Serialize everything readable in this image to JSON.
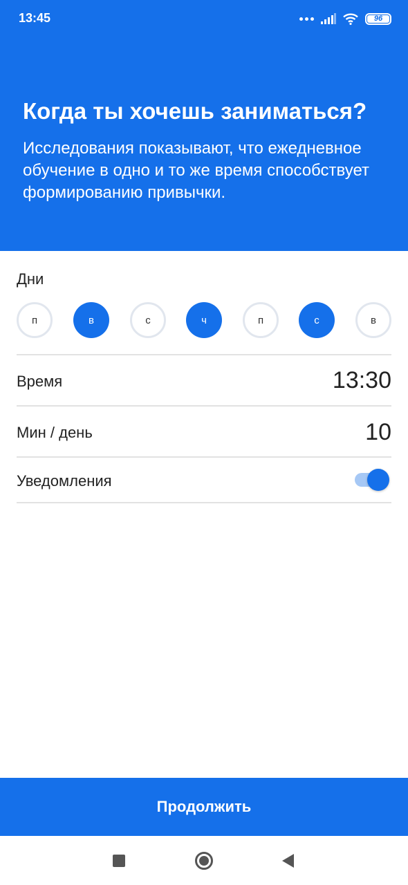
{
  "status_bar": {
    "time": "13:45",
    "battery": "96",
    "icons": [
      "dots-icon",
      "signal-icon",
      "wifi-icon",
      "battery-icon"
    ]
  },
  "header": {
    "title": "Когда ты хочешь заниматься?",
    "subtitle": "Исследования показывают, что ежедневное обучение в одно и то же время способствует формированию привычки."
  },
  "days": {
    "label": "Дни",
    "items": [
      {
        "letter": "п",
        "selected": false
      },
      {
        "letter": "в",
        "selected": true
      },
      {
        "letter": "с",
        "selected": false
      },
      {
        "letter": "ч",
        "selected": true
      },
      {
        "letter": "п",
        "selected": false
      },
      {
        "letter": "с",
        "selected": true
      },
      {
        "letter": "в",
        "selected": false
      }
    ]
  },
  "settings": {
    "time_label": "Время",
    "time_value": "13:30",
    "minutes_label": "Мин / день",
    "minutes_value": "10",
    "notifications_label": "Уведомления",
    "notifications_on": true
  },
  "continue_label": "Продолжить",
  "colors": {
    "accent": "#1570ea",
    "toggle_track": "#a6c8f5",
    "day_border": "#e1e6ee",
    "divider": "#e2e2e2"
  },
  "nav_bar": [
    "recents-icon",
    "home-icon",
    "back-icon"
  ]
}
